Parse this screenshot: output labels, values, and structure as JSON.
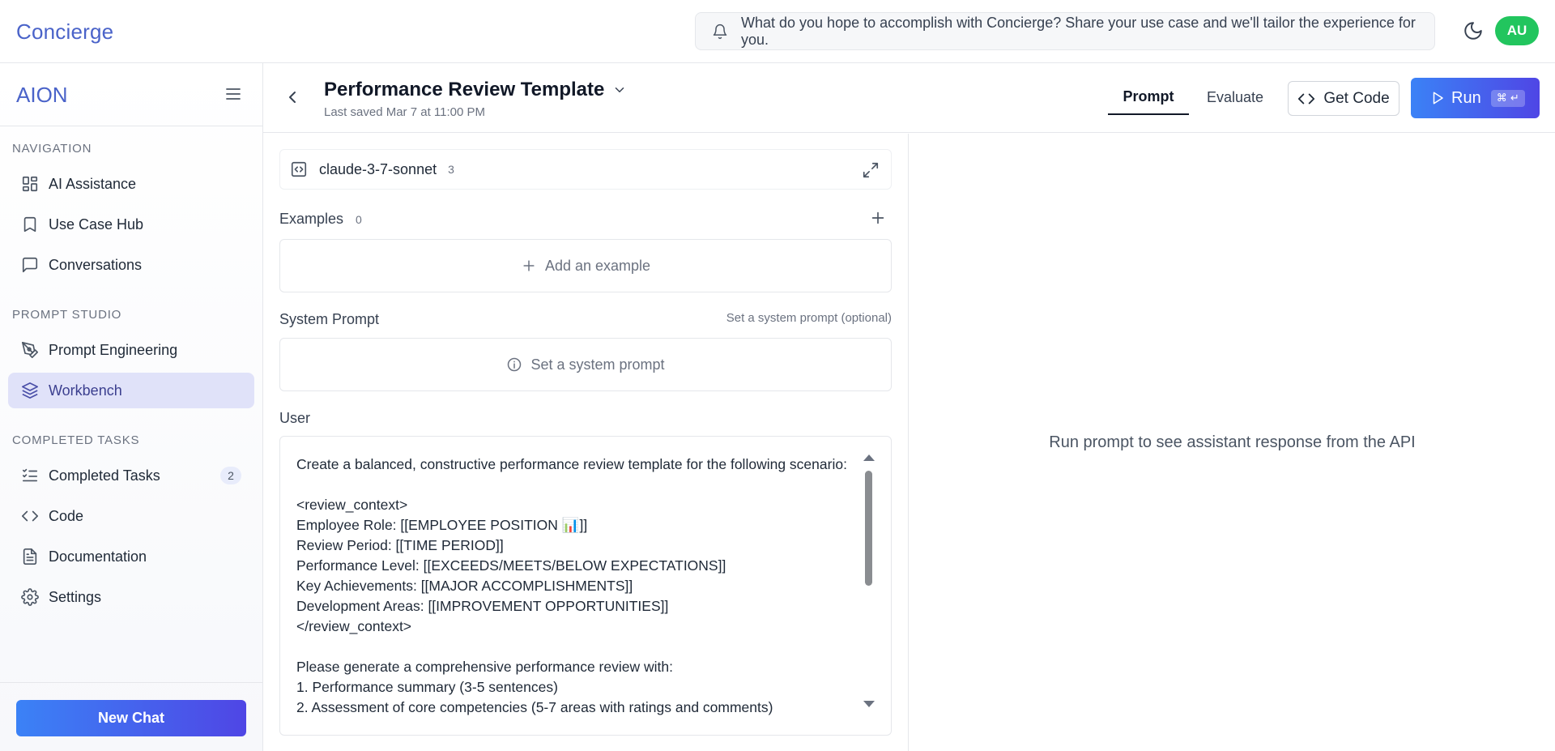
{
  "app": {
    "brand": "Concierge",
    "announcement": "What do you hope to accomplish with Concierge? Share your use case and we'll tailor the experience for you.",
    "avatar_initials": "AU",
    "accent_color": "#4a63c9",
    "avatar_color": "#22c55e"
  },
  "sidebar": {
    "org_name": "AION",
    "sections": [
      {
        "label": "NAVIGATION",
        "items": [
          {
            "label": "AI Assistance",
            "icon": "grid-icon"
          },
          {
            "label": "Use Case Hub",
            "icon": "bookmark-icon"
          },
          {
            "label": "Conversations",
            "icon": "chat-icon"
          }
        ]
      },
      {
        "label": "PROMPT STUDIO",
        "items": [
          {
            "label": "Prompt Engineering",
            "icon": "pen-tool-icon"
          },
          {
            "label": "Workbench",
            "icon": "layers-icon",
            "active": true
          }
        ]
      },
      {
        "label": "COMPLETED TASKS",
        "items": [
          {
            "label": "Completed Tasks",
            "icon": "list-checks-icon",
            "badge": "2"
          },
          {
            "label": "Code",
            "icon": "code-icon"
          },
          {
            "label": "Documentation",
            "icon": "file-text-icon"
          },
          {
            "label": "Settings",
            "icon": "gear-icon"
          }
        ]
      }
    ],
    "new_chat_label": "New Chat"
  },
  "header": {
    "title": "Performance Review Template",
    "saved_text": "Last saved Mar 7 at 11:00 PM",
    "tabs": [
      {
        "label": "Prompt",
        "active": true
      },
      {
        "label": "Evaluate",
        "active": false
      }
    ],
    "get_code_label": "Get Code",
    "run_label": "Run",
    "run_shortcut": "⌘ ↵"
  },
  "prompt": {
    "model_name": "claude-3-7-sonnet",
    "model_count": "3",
    "examples_label": "Examples",
    "examples_count": "0",
    "add_example_label": "Add an example",
    "system_prompt_label": "System Prompt",
    "system_prompt_hint": "Set a system prompt (optional)",
    "system_prompt_placeholder": "Set a system prompt",
    "user_label": "User",
    "user_message": "Create a balanced, constructive performance review template for the following scenario:\n\n<review_context>\nEmployee Role: [[EMPLOYEE POSITION 📊]]\nReview Period: [[TIME PERIOD]]\nPerformance Level: [[EXCEEDS/MEETS/BELOW EXPECTATIONS]]\nKey Achievements: [[MAJOR ACCOMPLISHMENTS]]\nDevelopment Areas: [[IMPROVEMENT OPPORTUNITIES]]\n</review_context>\n\nPlease generate a comprehensive performance review with:\n1. Performance summary (3-5 sentences)\n2. Assessment of core competencies (5-7 areas with ratings and comments)"
  },
  "response": {
    "empty_text": "Run prompt to see assistant response from the API"
  }
}
